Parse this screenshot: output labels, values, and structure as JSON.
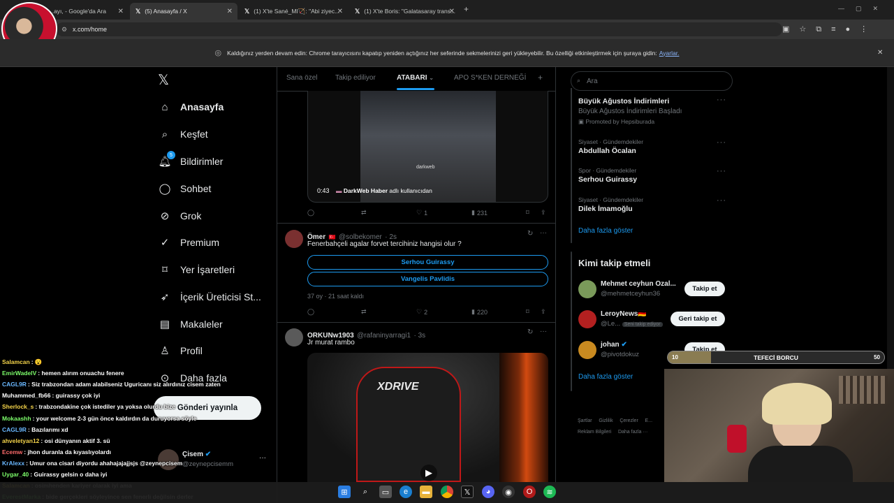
{
  "browser": {
    "tabs": [
      {
        "label": "...ayı, - Google'da Ara",
        "close": "✕"
      },
      {
        "label": "(5) Anasayfa / X",
        "close": "✕"
      },
      {
        "label": "(1) X'te Sané_MI🏹: \"Abi ziyec...",
        "close": "✕"
      },
      {
        "label": "(1) X'te Boris: \"Galatasaray trans...",
        "close": "✕"
      }
    ],
    "new_tab": "+",
    "url": "x.com/home",
    "infobar_text": "Kaldığınız yerden devam edin: Chrome tarayıcısını kapatıp yeniden açtığınız her seferinde sekmelerinizi geri yükleyebilir. Bu özelliği etkinleştirmek için şuraya gidin:",
    "infobar_link": "Ayarlar."
  },
  "nav": {
    "logo": "𝕏",
    "items": [
      {
        "label": "Anasayfa",
        "icon": "home-icon"
      },
      {
        "label": "Keşfet",
        "icon": "search-icon"
      },
      {
        "label": "Bildirimler",
        "icon": "bell-icon",
        "badge": "5"
      },
      {
        "label": "Sohbet",
        "icon": "chat-icon"
      },
      {
        "label": "Grok",
        "icon": "grok-icon"
      },
      {
        "label": "Premium",
        "icon": "premium-icon"
      },
      {
        "label": "Yer İşaretleri",
        "icon": "bookmark-icon"
      },
      {
        "label": "İçerik Üreticisi St...",
        "icon": "rocket-icon"
      },
      {
        "label": "Makaleler",
        "icon": "article-icon"
      },
      {
        "label": "Profil",
        "icon": "person-icon"
      },
      {
        "label": "Daha fazla",
        "icon": "more-circle-icon"
      }
    ],
    "post_button": "Gönderi yayınla",
    "account": {
      "name": "Çisem",
      "handle": "@zeynepcisemm"
    }
  },
  "feed_tabs": [
    "Sana özel",
    "Takip ediliyor",
    "ATABARI",
    "APO S*KEN DERNEĞİ"
  ],
  "feed_add": "+",
  "tweet1": {
    "video_time": "0:43",
    "video_source_name": "DarkWeb Haber",
    "video_source_suffix": "adlı kullanıcıdan",
    "watermark": "darkweb",
    "reply": "",
    "retweet": "",
    "like": "1",
    "views": "231"
  },
  "tweet2": {
    "name": "Ömer",
    "handle": "@solbekomer",
    "time": "· 2s",
    "text": "Fenerbahçeli agalar forvet tercihiniz hangisi olur ?",
    "options": [
      "Serhou Guirassy",
      "Vangelis Pavlidis"
    ],
    "poll_meta": "37 oy · 21 saat kaldı",
    "like": "2",
    "views": "220"
  },
  "tweet3": {
    "name": "ORKUNw1903",
    "handle": "@rafaninyarragi1",
    "time": "· 3s",
    "text": "Jr murat rambo",
    "chair_brand": "XDRIVE"
  },
  "right": {
    "search_placeholder": "Ara",
    "trends": [
      {
        "title": "Büyük Ağustos İndirimleri",
        "sub": "Büyük Ağustos İndirimleri Başladı",
        "promo": "Promoted by Hepsiburada"
      },
      {
        "meta": "Siyaset · Gündemdekiler",
        "title": "Abdullah Öcalan"
      },
      {
        "meta": "Spor · Gündemdekiler",
        "title": "Serhou Guirassy"
      },
      {
        "meta": "Siyaset · Gündemdekiler",
        "title": "Dilek İmamoğlu"
      }
    ],
    "trends_more": "Daha fazla göster",
    "who_to_follow_title": "Kimi takip etmeli",
    "follow": [
      {
        "name": "Mehmet ceyhun Özal...",
        "handle": "@mehmetceyhun36",
        "button": "Takip et"
      },
      {
        "name": "LeroyNews🇩🇪",
        "handle": "@Le...",
        "tag": "Seni takip ediyor",
        "button": "Geri takip et"
      },
      {
        "name": "johan",
        "handle": "@pivotdokuz",
        "button": "Takip et"
      }
    ],
    "follow_more": "Daha fazla göster",
    "footer": [
      "Şartlar",
      "Gizlilik",
      "Çerezler",
      "E...",
      "Reklam Bilgileri",
      "Daha fazla ···"
    ]
  },
  "stream_overlay": {
    "bar_left": "10",
    "bar_title": "TEFECİ BORCU",
    "bar_right": "50",
    "bar_fraction": 0.2,
    "chat": [
      {
        "name": "Salamcan",
        "msg": ": 😮",
        "color": "#f5d44a"
      },
      {
        "name": "EmirWadelV",
        "msg": ": hemen alırım onuachu fenere",
        "color": "#7cfc6a"
      },
      {
        "name": "CAGL9R",
        "msg": ": Siz trabzondan adam alabilseniz Uguricanı siz alırdınız cisem zaten",
        "color": "#6ab8ff"
      },
      {
        "name": "Muhammed_fb66",
        "msg": ": guirassy çok iyi",
        "color": "#ffffff"
      },
      {
        "name": "Sherlock_s",
        "msg": ": trabzondakine çok istediler ya yoksa olurdu bize",
        "color": "#f5d44a"
      },
      {
        "name": "Mokaashh",
        "msg": ": your welcome 2-3 gün önce kaldırdın da duruyorsa söyle",
        "color": "#7cfc6a"
      },
      {
        "name": "CAGL9R",
        "msg": ": Bazılarımı xd",
        "color": "#6ab8ff"
      },
      {
        "name": "ahveletyan12",
        "msg": ": osi dünyanın aktif 3. sü",
        "color": "#f5d44a"
      },
      {
        "name": "Ecemw",
        "msg": ": jhon duranla da kıyaslıyolardı",
        "color": "#ff6b6b"
      },
      {
        "name": "KrAlexx",
        "msg": ": Umur ona cisari diyordu ahahajajajjsjs @zeynepcisem",
        "color": "#6ab8ff"
      },
      {
        "name": "Uygar_40",
        "msg": ": Guirassy gelsin o daha iyi",
        "color": "#7cfc6a"
      },
      {
        "name": "Salamcan",
        "msg": ": osimhenden kariyer olarak iyi ama",
        "color": "#f5d44a"
      },
      {
        "name": "EverestMarka",
        "msg": ": bide gerçekleri söyleyince sen fenerli değilsin derler",
        "color": "#7cfc6a"
      }
    ]
  }
}
